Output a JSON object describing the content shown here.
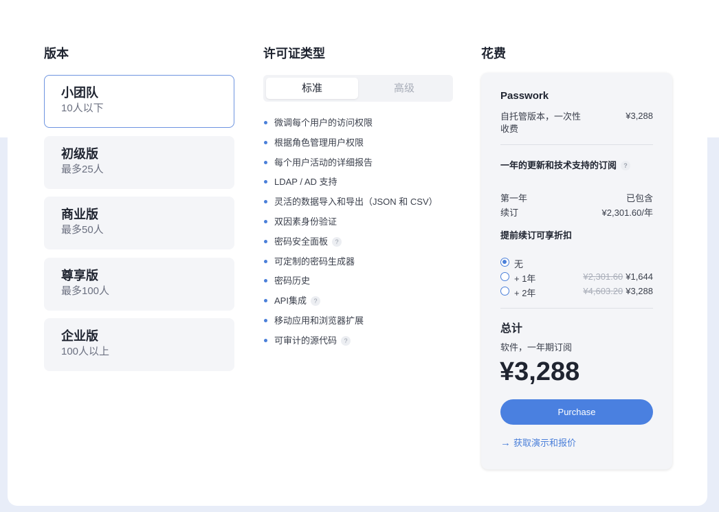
{
  "columns": {
    "edition_title": "版本",
    "license_title": "许可证类型",
    "cost_title": "花费"
  },
  "editions": [
    {
      "name": "小团队",
      "sub": "10人以下",
      "selected": true
    },
    {
      "name": "初级版",
      "sub": "最多25人",
      "selected": false
    },
    {
      "name": "商业版",
      "sub": "最多50人",
      "selected": false
    },
    {
      "name": "尊享版",
      "sub": "最多100人",
      "selected": false
    },
    {
      "name": "企业版",
      "sub": "100人以上",
      "selected": false
    }
  ],
  "license_tabs": [
    {
      "label": "标准",
      "active": true
    },
    {
      "label": "高级",
      "active": false
    }
  ],
  "features": [
    {
      "text": "微调每个用户的访问权限",
      "help": false
    },
    {
      "text": "根据角色管理用户权限",
      "help": false
    },
    {
      "text": "每个用户活动的详细报告",
      "help": false
    },
    {
      "text": "LDAP / AD 支持",
      "help": false
    },
    {
      "text": "灵活的数据导入和导出（JSON 和 CSV）",
      "help": false
    },
    {
      "text": "双因素身份验证",
      "help": false
    },
    {
      "text": "密码安全面板",
      "help": true
    },
    {
      "text": "可定制的密码生成器",
      "help": false
    },
    {
      "text": "密码历史",
      "help": false
    },
    {
      "text": "API集成",
      "help": true
    },
    {
      "text": "移动应用和浏览器扩展",
      "help": false
    },
    {
      "text": "可审计的源代码",
      "help": true
    }
  ],
  "help_glyph": "?",
  "cost": {
    "product": "Passwork",
    "selfhost_label": "自托管版本，一次性收费",
    "selfhost_price": "¥3,288",
    "subscription_title": "一年的更新和技术支持的订阅",
    "first_year_label": "第一年",
    "first_year_value": "已包含",
    "renew_label": "续订",
    "renew_value": "¥2,301.60/年",
    "discount_title": "提前续订可享折扣",
    "options": [
      {
        "label": "无",
        "old_price": "",
        "new_price": "",
        "checked": true
      },
      {
        "label": "+ 1年",
        "old_price": "¥2,301.60",
        "new_price": "¥1,644",
        "checked": false
      },
      {
        "label": "+ 2年",
        "old_price": "¥4,603.20",
        "new_price": "¥3,288",
        "checked": false
      }
    ],
    "total_title": "总计",
    "total_sub": "软件，一年期订阅",
    "total_amount": "¥3,288",
    "purchase_label": "Purchase",
    "demo_arrow": "→",
    "demo_label": "获取演示和报价"
  },
  "colors": {
    "accent": "#4a80e0",
    "selected_border": "#6c93e0",
    "card_bg": "#f4f5f8"
  }
}
